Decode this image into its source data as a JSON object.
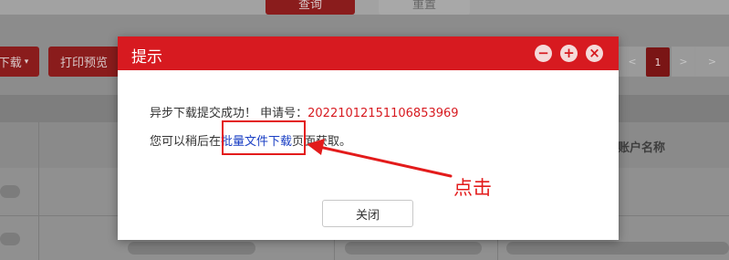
{
  "background": {
    "query_button": "查询",
    "reset_button": "重置",
    "download_button": "下载",
    "print_preview_button": "打印预览",
    "pager": {
      "prev": "<",
      "current": "1",
      "next": ">",
      "last": ">"
    },
    "column_account_name": "账户名称"
  },
  "dialog": {
    "title": "提示",
    "message_prefix": "异步下载提交成功！ 申请号：",
    "request_no": "20221012151106853969",
    "line2_prefix": "您可以稍后在",
    "batch_download_link": "批量文件下载",
    "line2_suffix": "页面获取。",
    "close_button": "关闭",
    "icons": [
      "minimize-icon",
      "maximize-icon",
      "close-icon"
    ]
  },
  "annotation": {
    "label": "点击",
    "color": "#e31b1b"
  },
  "colors": {
    "header_red": "#d71a20",
    "link_blue": "#1a3fc4"
  }
}
